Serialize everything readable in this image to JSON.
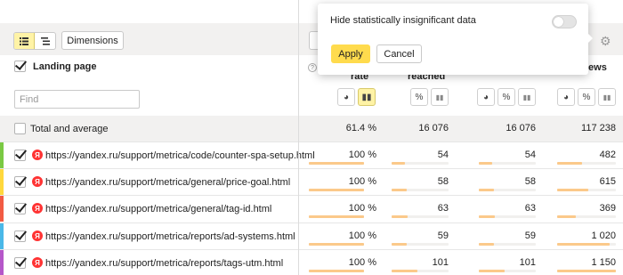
{
  "toolbar": {
    "dimensions_label": "Dimensions",
    "view_list_icon": "list-view-icon",
    "view_tree_icon": "tree-view-icon",
    "settings_icon": "gear-icon"
  },
  "left": {
    "landing_page_label": "Landing page",
    "find_placeholder": "Find"
  },
  "columns": {
    "col1_title": "rate",
    "col2_title": "reached",
    "col4_title": "iews"
  },
  "popup": {
    "label": "Hide statistically insignificant data",
    "toggle_on": false,
    "apply_label": "Apply",
    "cancel_label": "Cancel"
  },
  "total": {
    "label": "Total and average",
    "v1": "61.4 %",
    "v2": "16 076",
    "v3": "16 076",
    "v4": "117 238"
  },
  "rows": [
    {
      "url": "https://yandex.ru/support/metrica/code/counter-spa-setup.html",
      "stripe": "#7ac943",
      "v1": "100 %",
      "v2": "54",
      "v3": "54",
      "v4": "482"
    },
    {
      "url": "https://yandex.ru/support/metrica/general/price-goal.html",
      "stripe": "#ffd83d",
      "v1": "100 %",
      "v2": "58",
      "v3": "58",
      "v4": "615"
    },
    {
      "url": "https://yandex.ru/support/metrica/general/tag-id.html",
      "stripe": "#f25b43",
      "v1": "100 %",
      "v2": "63",
      "v3": "63",
      "v4": "369"
    },
    {
      "url": "https://yandex.ru/support/metrica/reports/ad-systems.html",
      "stripe": "#4ab8e8",
      "v1": "100 %",
      "v2": "59",
      "v3": "59",
      "v4": "1 020"
    },
    {
      "url": "https://yandex.ru/support/metrica/reports/tags-utm.html",
      "stripe": "#b557c9",
      "v1": "100 %",
      "v2": "101",
      "v3": "101",
      "v4": "1 150"
    }
  ],
  "colors": {
    "accent_yellow": "#ffdb4d",
    "bar_fill": "#fbc98a",
    "toolbar_bg": "#f2f1f0"
  }
}
